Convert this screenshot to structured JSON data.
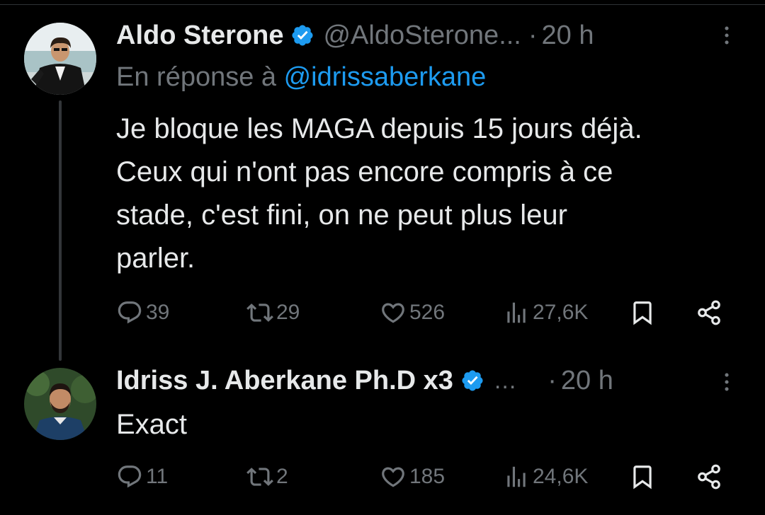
{
  "colors": {
    "background": "#000000",
    "text": "#e7e9ea",
    "secondary": "#71767b",
    "accent": "#1d9bf0",
    "divider": "#2f3336"
  },
  "tweets": [
    {
      "author_name": "Aldo Sterone",
      "author_handle": "@AldoSterone...",
      "time": "20 h",
      "reply_prefix": "En réponse à ",
      "reply_mention": "@idrissaberkane",
      "body_lines": [
        "Je bloque les MAGA depuis 15 jours déjà.",
        "Ceux qui n'ont pas encore compris à ce",
        "stade, c'est fini, on ne peut plus leur",
        "parler."
      ],
      "replies": "39",
      "reposts": "29",
      "likes": "526",
      "views": "27,6K",
      "avatar_icon": "person-in-suit-avatar"
    },
    {
      "author_name": "Idriss J. Aberkane Ph.D x3",
      "name_ellipsis": "...",
      "time": "20 h",
      "body_lines": [
        "Exact"
      ],
      "replies": "11",
      "reposts": "2",
      "likes": "185",
      "views": "24,6K",
      "avatar_icon": "bearded-man-avatar"
    }
  ],
  "icons": {
    "verified": "verified-badge-icon",
    "more": "more-vertical-icon",
    "reply": "reply-icon",
    "repost": "repost-icon",
    "like": "heart-icon",
    "views": "views-chart-icon",
    "bookmark": "bookmark-icon",
    "share": "share-icon"
  },
  "separator_dot": "·"
}
